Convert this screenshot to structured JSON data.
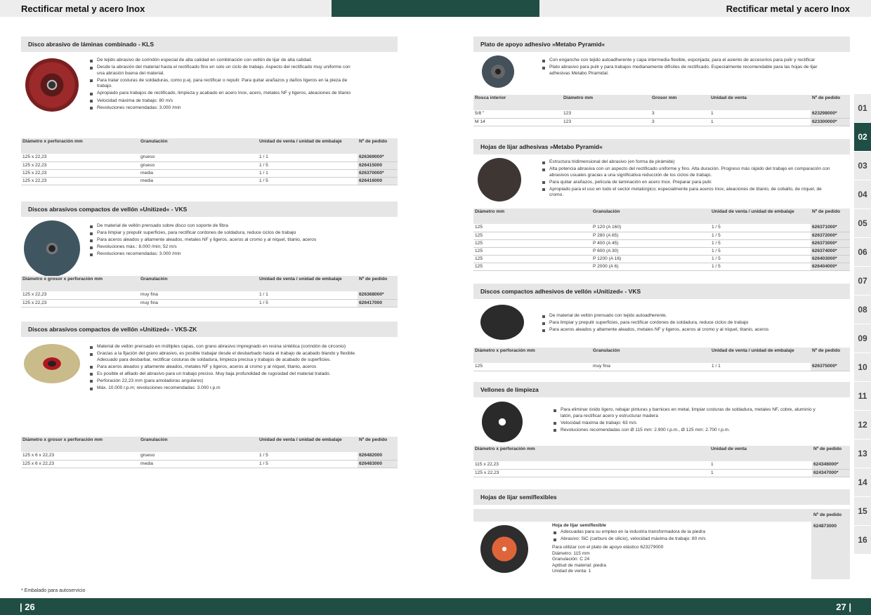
{
  "header": {
    "left_title": "Rectificar metal y acero Inox",
    "right_title": "Rectificar metal y acero Inox"
  },
  "footer": {
    "left_page": "| 26",
    "right_page": "27 |",
    "note": "* Embalado para autoservicio"
  },
  "tabs": [
    "01",
    "02",
    "03",
    "04",
    "05",
    "06",
    "07",
    "08",
    "09",
    "10",
    "11",
    "12",
    "13",
    "14",
    "15",
    "16"
  ],
  "active_tab": "02",
  "kls": {
    "title": "Disco abrasivo de láminas combinado - KLS",
    "bullets": [
      "De tejido abrasivo de corindón especial de alta calidad en combinación con vellón de lijar de alta calidad.",
      "Desde la abrasión del material hasta el rectificado fino en solo un ciclo de trabajo. Aspecto del rectificado muy uniforme con una abrasión buena del material.",
      "Para tratar costuras de soldaduras, como p.ej. para rectificar o repulir. Para quitar arañazos y daños ligeros en la pieza de trabajo.",
      "Apropiado para trabajos de rectificado, limpieza y acabado en acero Inox, acero, metales NF y ligeros, aleaciones de titanio",
      "Velocidad máxima de trabajo: 80 m/s",
      "Revoluciones recomendadas: 3.000 /min"
    ],
    "headers": [
      "Diámetro x perforación mm",
      "Granulación",
      "Unidad de venta / unidad de embalaje",
      "Nº de pedido"
    ],
    "rows": [
      [
        "125 x 22,23",
        "grueso",
        "1 / 1",
        "626369000*"
      ],
      [
        "125 x 22,23",
        "grueso",
        "1 / 5",
        "626415000"
      ],
      [
        "125 x 22,23",
        "media",
        "1 / 1",
        "626370000*"
      ],
      [
        "125 x 22,23",
        "media",
        "1 / 5",
        "626416000"
      ]
    ]
  },
  "vks": {
    "title": "Discos abrasivos compactos de vellón »Unitized« - VKS",
    "bullets": [
      "De material de vellón prensado sobre disco con soporte de fibra",
      "Para limpiar y prepulir superficies, para rectificar cordones de soldadura, reduce ciclos de trabajo",
      "Para aceros aleados y altamente aleados, metales NF y ligeros, aceros al cromo y al níquel, titanio, aceros",
      "Revoluciones máx.: 8.000 /min; 52 m/s",
      "Revoluciones recomendadas: 3.000 /min"
    ],
    "headers": [
      "Diámetro x grosor x perforación mm",
      "Granulación",
      "Unidad de venta / unidad de embalaje",
      "Nº de pedido"
    ],
    "rows": [
      [
        "125 x 22,23",
        "muy fina",
        "1 / 1",
        "626368000*"
      ],
      [
        "125 x 22,23",
        "muy fina",
        "1 / 5",
        "626417000"
      ]
    ]
  },
  "vkszk": {
    "title": "Discos abrasivos compactos de vellón »Unitized« - VKS-ZK",
    "bullets": [
      "Material de vellón prensado en múltiples capas, con grano abrasivo impregnado en resina sintética (corindón de circonio)",
      "Gracias a la fijación del grano abrasivo, es posible trabajar desde el desbarbado hasta el trabajo de acabado blando y flexible. Adecuado para desbarbar, rectificar costuras de soldadura, limpieza precisa y trabajos de acabado de superficies.",
      "Para aceros aleados y altamente aleados, metales NF y ligeros, aceros al cromo y al níquel, titanio, aceros",
      "Es posible el afilado del abrasivo para un trabajo preciso. Muy baja profundidad de rugosidad del material tratado.",
      "Perforación 22,23 mm (para amoladoras angulares)",
      "Máx. 10.000 r.p.m; revoluciones recomendadas: 3.000 r.p.m"
    ],
    "headers": [
      "Diámetro x grosor x perforación mm",
      "Granulación",
      "Unidad de venta / unidad de embalaje",
      "Nº de pedido"
    ],
    "rows": [
      [
        "125 x 6 x 22,23",
        "grueso",
        "1 / 5",
        "626482000"
      ],
      [
        "125 x 6 x 22,23",
        "media",
        "1 / 5",
        "626483000"
      ]
    ]
  },
  "plato": {
    "title": "Plato de apoyo adhesivo »Metabo Pyramid«",
    "bullets": [
      "Con enganche con tejido autoadherente y capa intermedia flexible, esponjada; para el asiento de accesorios para pulir y rectificar",
      "Plato abrasivo para pulir y para trabajos medianamente difíciles de rectificado. Especialmente recomendable para las hojas de lijar adhesivas Metabo Piramidal."
    ],
    "headers": [
      "Rosca interior",
      "Diámetro mm",
      "Grosor mm",
      "Unidad de venta",
      "Nº de pedido"
    ],
    "rows": [
      [
        "5/8 \"",
        "123",
        "3",
        "1",
        "623298000*"
      ],
      [
        "M 14",
        "123",
        "3",
        "1",
        "623300000*"
      ]
    ]
  },
  "hojas": {
    "title": "Hojas de lijar adhesivas »Metabo Pyramid«",
    "bullets": [
      "Estructura tridimensional del abrasivo (en forma de pirámide)",
      "Alta potencia abrasiva con un aspecto del rectificado uniforme y fino. Alta duración. Progreso más rápido del trabajo en comparación con abrasivos usuales gracias a una significativa reducción de los ciclos de trabajo.",
      "Para quitar arañazos, película de laminación en acero Inox. Preparar para pulir.",
      "Apropiado para el uso en todo el sector metalúrgico; especialmente para aceros Inox, aleaciones de titanio, de cobalto, de níquel, de cromo."
    ],
    "headers": [
      "Diámetro mm",
      "Granulación",
      "Unidad de venta / unidad de embalaje",
      "Nº de pedido"
    ],
    "rows": [
      [
        "125",
        "P 120 (A 160)",
        "1 / 5",
        "626371000*"
      ],
      [
        "125",
        "P 280 (A 65)",
        "1 / 5",
        "626372000*"
      ],
      [
        "125",
        "P 400 (A 45)",
        "1 / 5",
        "626373000*"
      ],
      [
        "125",
        "P 600 (A 30)",
        "1 / 5",
        "626374000*"
      ],
      [
        "125",
        "P 1200 (A 16)",
        "1 / 5",
        "626403000*"
      ],
      [
        "125",
        "P 2000 (A 6)",
        "1 / 5",
        "626404000*"
      ]
    ]
  },
  "vks2": {
    "title": "Discos compactos adhesivos de vellón »Unitized« - VKS",
    "bullets": [
      "De material de vellón prensado con tejido autoadherente.",
      "Para limpiar y prepulir superficies, para rectificar cordones de soldadura, reduce ciclos de trabajo",
      "Para aceros aleados y altamente aleados, metales NF y ligeros, aceros al cromo y al níquel, titanio, aceros"
    ],
    "headers": [
      "Diámetro x perforación mm",
      "Granulación",
      "Unidad de venta / unidad de embalaje",
      "Nº de pedido"
    ],
    "rows": [
      [
        "125",
        "muy fina",
        "1 / 1",
        "626375000*"
      ]
    ]
  },
  "vellones": {
    "title": "Vellones de limpieza",
    "bullets": [
      "Para eliminar óxido ligero, rebajar pinturas y barnices en metal, limpiar costuras de soldadura, metales NF, cobre, aluminio y latón, para rectificar acero y estructurar madera",
      "Velocidad máxima de trabajo: 63 m/s",
      "Revoluciones recomendadas con Ø 115 mm: 2.900 r.p.m., Ø 125 mm: 2.700 r.p.m."
    ],
    "headers": [
      "Diámetro x perforación mm",
      "Unidad de venta",
      "Nº de pedido"
    ],
    "rows": [
      [
        "115 x 22,23",
        "1",
        "624346000*"
      ],
      [
        "125 x 22,23",
        "1",
        "624347000*"
      ]
    ]
  },
  "semi": {
    "title": "Hojas de lijar semiflexibles",
    "order_header": "Nº de pedido",
    "product": "Hoja de lijar semiflexible",
    "order": "624873000",
    "bullets": [
      "Adecuadas para su empleo en la industria transformadora de la piedra",
      "Abrasivo: SiC (carburo de silicio), velocidad máxima de trabajo: 80 m/s"
    ],
    "details": [
      "Para utilizar con el plato de apoyo elástico 623279000",
      "Diámetro: 115 mm",
      "Granulación: C 24",
      "Aptitud de material: piedra",
      "Unidad de venta: 1"
    ]
  }
}
